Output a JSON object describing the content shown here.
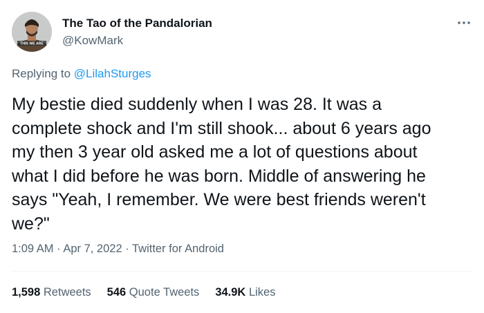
{
  "author": {
    "display_name": "The Tao of the Pandalorian",
    "handle": "@KowMark",
    "avatar_caption": "THIS WE ARE"
  },
  "reply": {
    "prefix": "Replying to ",
    "to_handle": "@LilahSturges"
  },
  "tweet": {
    "text": "My bestie died suddenly when I was 28. It was a\ncomplete shock and I'm still shook... about 6 years ago\nmy then 3 year old asked me a lot of questions about\nwhat I did before he was born. Middle of answering he\nsays \"Yeah, I remember. We were best friends weren't\nwe?\""
  },
  "meta": {
    "time": "1:09 AM",
    "separator": " · ",
    "date": "Apr 7, 2022",
    "source": "Twitter for Android"
  },
  "stats": {
    "retweets_count": "1,598",
    "retweets_label": "Retweets",
    "quote_tweets_count": "546",
    "quote_tweets_label": "Quote Tweets",
    "likes_count": "34.9K",
    "likes_label": "Likes"
  },
  "icons": {
    "more": "more-horizontal-icon"
  }
}
